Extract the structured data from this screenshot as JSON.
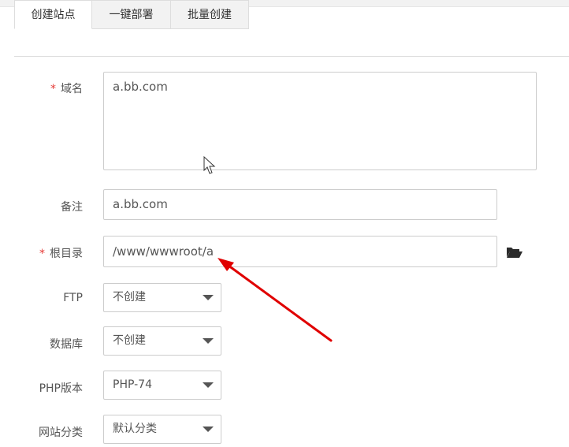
{
  "tabs": [
    {
      "label": "创建站点",
      "active": true
    },
    {
      "label": "一键部署",
      "active": false
    },
    {
      "label": "批量创建",
      "active": false
    }
  ],
  "form": {
    "required_marker": "*",
    "domain": {
      "label": "域名",
      "value": "a.bb.com"
    },
    "note": {
      "label": "备注",
      "value": "a.bb.com"
    },
    "root": {
      "label": "根目录",
      "value": "/www/wwwroot/a",
      "browse_icon": "folder-open-icon"
    },
    "ftp": {
      "label": "FTP",
      "selected": "不创建"
    },
    "database": {
      "label": "数据库",
      "selected": "不创建"
    },
    "php": {
      "label": "PHP版本",
      "selected": "PHP-74"
    },
    "category": {
      "label": "网站分类",
      "selected": "默认分类"
    }
  },
  "colors": {
    "required": "#e53935",
    "annotation_arrow": "#e00000"
  }
}
